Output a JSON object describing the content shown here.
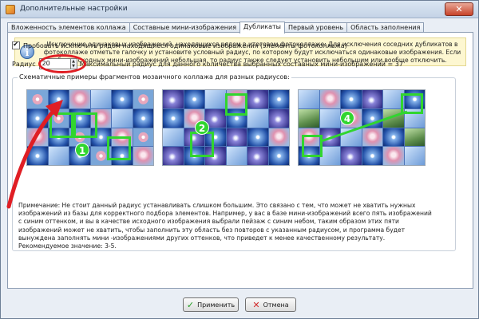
{
  "window": {
    "title": "Дополнительные настройки",
    "close_label": "✕"
  },
  "tabs": [
    {
      "label": "Вложенность элементов коллажа",
      "active": false
    },
    {
      "label": "Составные мини-изображения",
      "active": false
    },
    {
      "label": "Дубликаты",
      "active": true
    },
    {
      "label": "Первый уровень",
      "active": false
    },
    {
      "label": "Область заполнения",
      "active": false
    }
  ],
  "info": {
    "text": "Исключение одинаковых изображений, находящихся рядом в итоговом фотоколлаже: Для исключения соседних дубликатов в фотоколлаже отметьте галочку и установите условный радиус, по которому будут исключаться одинаковые изображения. Если база исходных мини-изображений небольшая, то радиус также следует установить небольшим или вообще отключить."
  },
  "checkbox": {
    "label": "Пробовать исключить рядом находящиеся одинаковые изображения (элементы фотоколлажа)",
    "checked": true
  },
  "radius": {
    "label": "Радиус",
    "value": "20",
    "max_text": "Максимальный радиус для данного количества выбранных составных мини-изображений = 37"
  },
  "examples": {
    "label": "Схематичные примеры фрагментов мозаичного коллажа для разных радиусов:",
    "badges": [
      "1",
      "2",
      "4"
    ]
  },
  "note": "Примечание: Не стоит данный радиус устанавливать слишком большим. Это связано с тем, что может не хватить нужных изображений из базы для корректного подбора элементов. Например, у вас в базе мини-изображений всего пять изображений с синим оттенком, и вы в качестве исходного изображения выбрали пейзаж с синим небом, таким образом этих пяти изображений может не хватить, чтобы заполнить эту область без повторов с указанным радиусом, и программа будет вынуждена заполнять мини -изображениями других оттенков, что приведет к менее качественному результату. Рекомендуемое значение: 3-5.",
  "buttons": {
    "apply": "Применить",
    "cancel": "Отмена"
  },
  "colors": {
    "highlight": "#31d52f",
    "annotation": "#e01e24"
  }
}
